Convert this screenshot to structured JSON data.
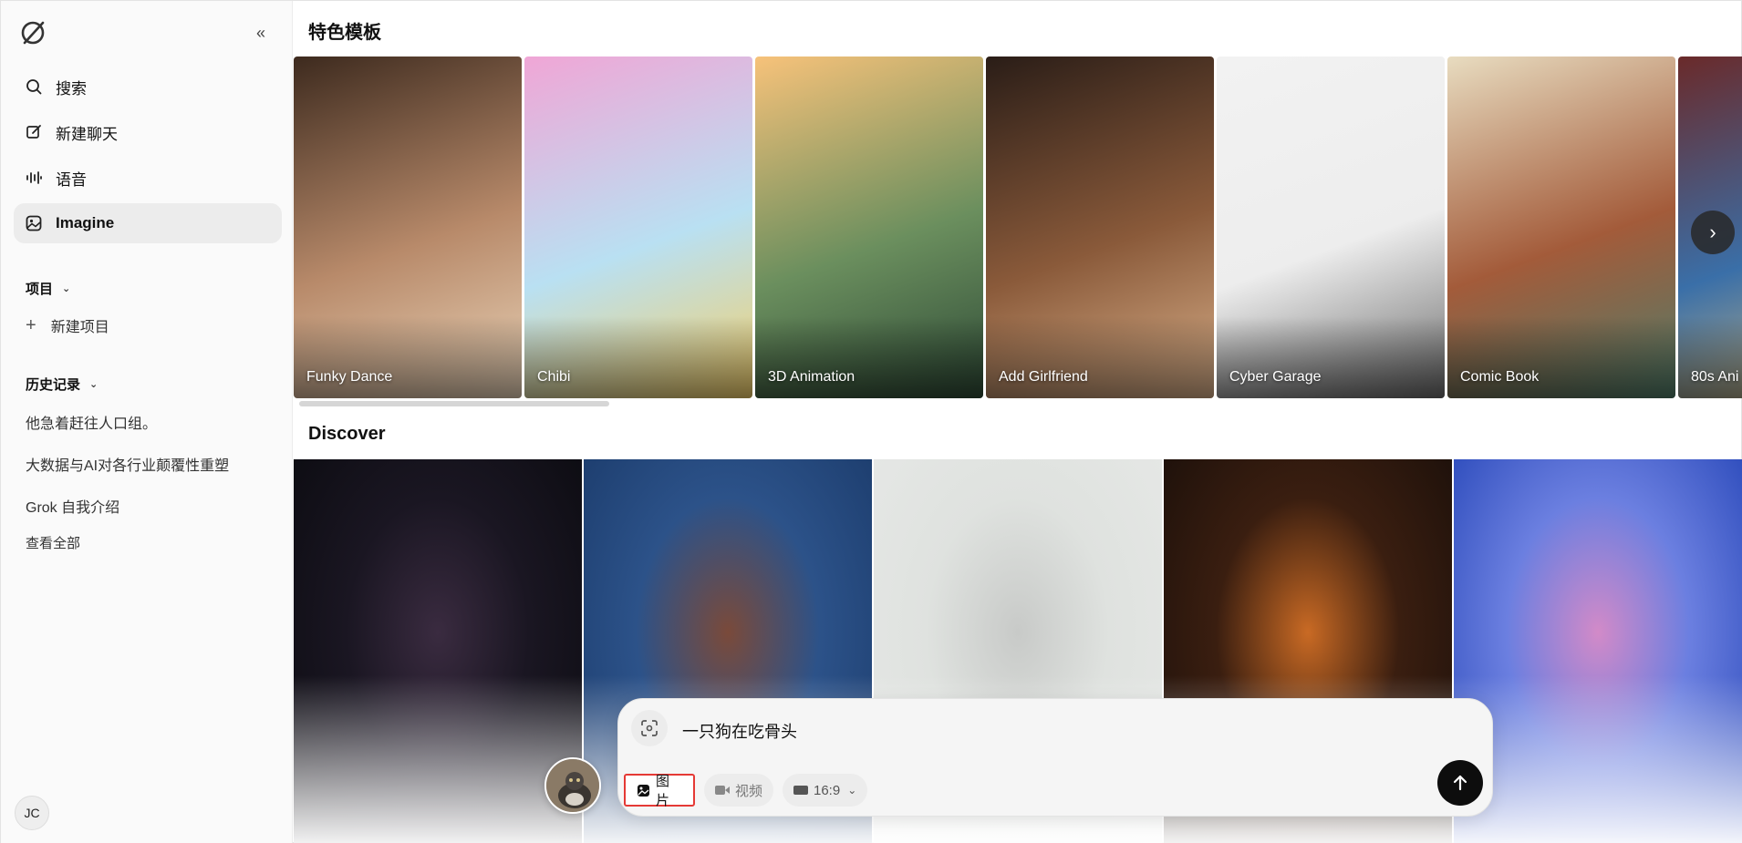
{
  "sidebar": {
    "nav": [
      {
        "label": "搜索",
        "icon": "search-icon"
      },
      {
        "label": "新建聊天",
        "icon": "edit-icon"
      },
      {
        "label": "语音",
        "icon": "voice-wave-icon"
      },
      {
        "label": "Imagine",
        "icon": "imagine-icon"
      }
    ],
    "projects": {
      "heading": "项目",
      "new_label": "新建项目"
    },
    "history": {
      "heading": "历史记录",
      "items": [
        "他急着赶往人口组。",
        "大数据与AI对各行业颠覆性重塑",
        "Grok 自我介绍"
      ],
      "see_all": "查看全部"
    },
    "user_initials": "JC"
  },
  "main": {
    "templates_heading": "特色模板",
    "templates": [
      {
        "label": "Funky Dance",
        "colors": [
          "#3d2a1e",
          "#b88a6a",
          "#e9d3b8"
        ]
      },
      {
        "label": "Chibi",
        "colors": [
          "#f0a6d6",
          "#b9e0f2",
          "#f4d06a"
        ]
      },
      {
        "label": "3D Animation",
        "colors": [
          "#f7c27a",
          "#6b8f5e",
          "#2e4a36"
        ]
      },
      {
        "label": "Add Girlfriend",
        "colors": [
          "#2a1d17",
          "#8a5a3a",
          "#d9b08a"
        ]
      },
      {
        "label": "Cyber Garage",
        "colors": [
          "#f2f2f2",
          "#ededed",
          "#6b6b6b"
        ]
      },
      {
        "label": "Comic Book",
        "colors": [
          "#e8dcc0",
          "#a35b3a",
          "#4f7d6a"
        ]
      },
      {
        "label": "80s Ani",
        "colors": [
          "#6a2a2a",
          "#3a6fa8",
          "#e0c07a"
        ]
      }
    ],
    "discover_heading": "Discover",
    "discover_colors": [
      [
        "#0b0b10",
        "#1a1622",
        "#3a2b40"
      ],
      [
        "#1b3b6b",
        "#2c5289",
        "#7a4a3a"
      ],
      [
        "#e6e8e6",
        "#dfe2df",
        "#c8cac8"
      ],
      [
        "#1a0f0a",
        "#3a1e10",
        "#c96a24"
      ],
      [
        "#2747b8",
        "#6b7fe0",
        "#d28ac8"
      ]
    ]
  },
  "composer": {
    "prompt_text": "一只狗在吃骨头",
    "modes": {
      "image": "图片",
      "video": "视频",
      "ratio": "16:9"
    }
  }
}
